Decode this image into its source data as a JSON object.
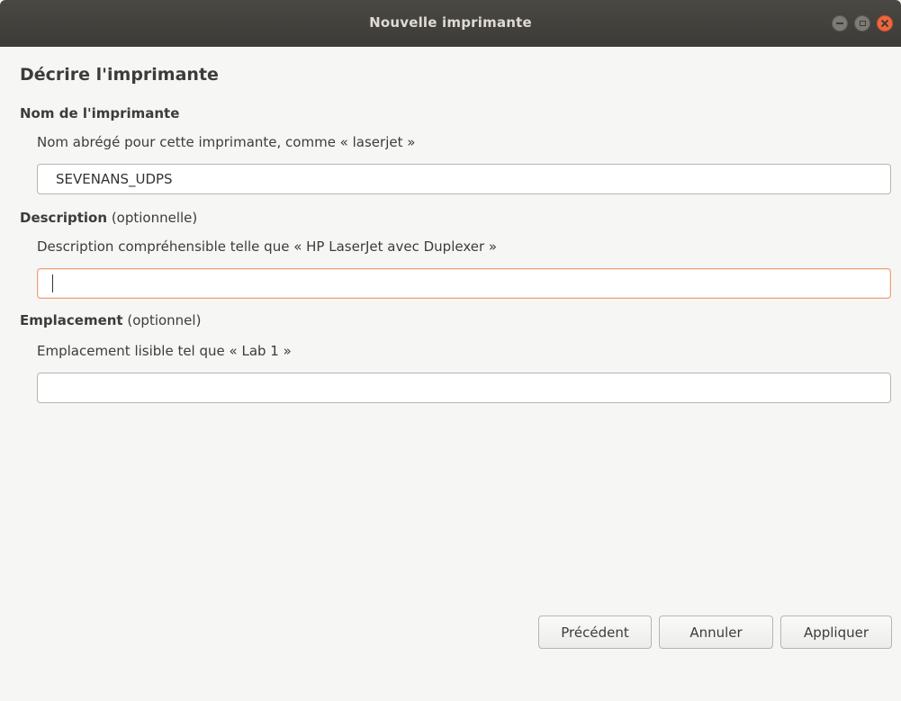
{
  "window": {
    "title": "Nouvelle imprimante",
    "controls": {
      "minimize_icon": "minimize-icon",
      "maximize_icon": "maximize-icon",
      "close_icon": "close-icon"
    }
  },
  "page": {
    "heading": "Décrire l'imprimante"
  },
  "name_section": {
    "label": "Nom de l'imprimante",
    "hint": "Nom abrégé pour cette imprimante, comme « laserjet »",
    "value": "SEVENANS_UDPS"
  },
  "description_section": {
    "label": "Description",
    "optional": "(optionnelle)",
    "hint": "Description compréhensible telle que « HP LaserJet avec Duplexer »",
    "value": ""
  },
  "location_section": {
    "label": "Emplacement",
    "optional": "(optionnel)",
    "hint": "Emplacement lisible tel que « Lab 1 »",
    "value": ""
  },
  "buttons": {
    "previous": "Précédent",
    "cancel": "Annuler",
    "apply": "Appliquer"
  },
  "colors": {
    "titlebar": "#3c3b37",
    "close_button": "#f0673c",
    "focus_border": "#f0a080",
    "background": "#f6f6f5"
  }
}
